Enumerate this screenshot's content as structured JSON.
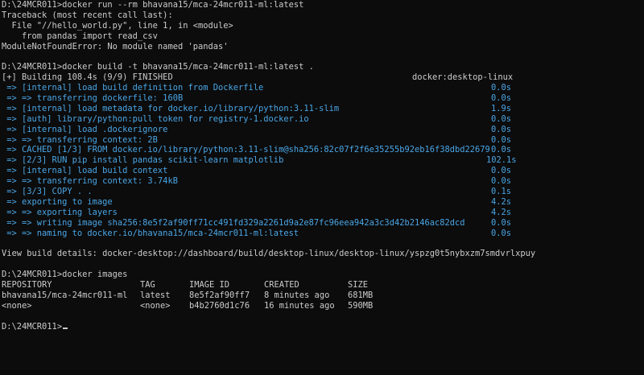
{
  "terminal": {
    "prompt": "D:\\24MCR011>",
    "run_cmd": "docker run --rm bhavana15/mca-24mcr011-ml:latest",
    "traceback": [
      "Traceback (most recent call last):",
      "  File \"//hello_world.py\", line 1, in <module>",
      "    from pandas import read_csv",
      "ModuleNotFoundError: No module named 'pandas'"
    ],
    "build_cmd": "docker build -t bhavana15/mca-24mcr011-ml:latest .",
    "build_header": {
      "text": "[+] Building 108.4s (9/9) FINISHED",
      "context": "docker:desktop-linux"
    },
    "build_steps": [
      {
        "text": " => [internal] load build definition from Dockerfile",
        "time": "0.0s"
      },
      {
        "text": " => => transferring dockerfile: 160B",
        "time": "0.0s"
      },
      {
        "text": " => [internal] load metadata for docker.io/library/python:3.11-slim",
        "time": "1.9s"
      },
      {
        "text": " => [auth] library/python:pull token for registry-1.docker.io",
        "time": "0.0s"
      },
      {
        "text": " => [internal] load .dockerignore",
        "time": "0.0s"
      },
      {
        "text": " => => transferring context: 2B",
        "time": "0.0s"
      },
      {
        "text": " => CACHED [1/3] FROM docker.io/library/python:3.11-slim@sha256:82c07f2f6e35255b92eb16f38dbd22679",
        "time": "0.0s"
      },
      {
        "text": " => [2/3] RUN pip install pandas scikit-learn matplotlib",
        "time": "102.1s"
      },
      {
        "text": " => [internal] load build context",
        "time": "0.0s"
      },
      {
        "text": " => => transferring context: 3.74kB",
        "time": "0.0s"
      },
      {
        "text": " => [3/3] COPY . .",
        "time": "0.1s"
      },
      {
        "text": " => exporting to image",
        "time": "4.2s"
      },
      {
        "text": " => => exporting layers",
        "time": "4.2s"
      },
      {
        "text": " => => writing image sha256:8e5f2af90ff71cc491fd329a2261d9a2e87fc96eea942a3c3d42b2146ac82dcd",
        "time": "0.0s"
      },
      {
        "text": " => => naming to docker.io/bhavana15/mca-24mcr011-ml:latest",
        "time": "0.0s"
      }
    ],
    "view_details": "View build details: docker-desktop://dashboard/build/desktop-linux/desktop-linux/yspzg0t5nybxzm7smdvrlxpuy",
    "images_cmd": "docker images",
    "images_table": {
      "headers": [
        "REPOSITORY",
        "TAG",
        "IMAGE ID",
        "CREATED",
        "SIZE"
      ],
      "rows": [
        [
          "bhavana15/mca-24mcr011-ml",
          "latest",
          "8e5f2af90ff7",
          "8 minutes ago",
          "681MB"
        ],
        [
          "<none>",
          "<none>",
          "b4b2760d1c76",
          "16 minutes ago",
          "590MB"
        ]
      ]
    },
    "final_prompt": "D:\\24MCR011>",
    "colors": {
      "background": "#0c0c0c",
      "foreground": "#cccccc",
      "build_step": "#4aa6e6"
    }
  }
}
